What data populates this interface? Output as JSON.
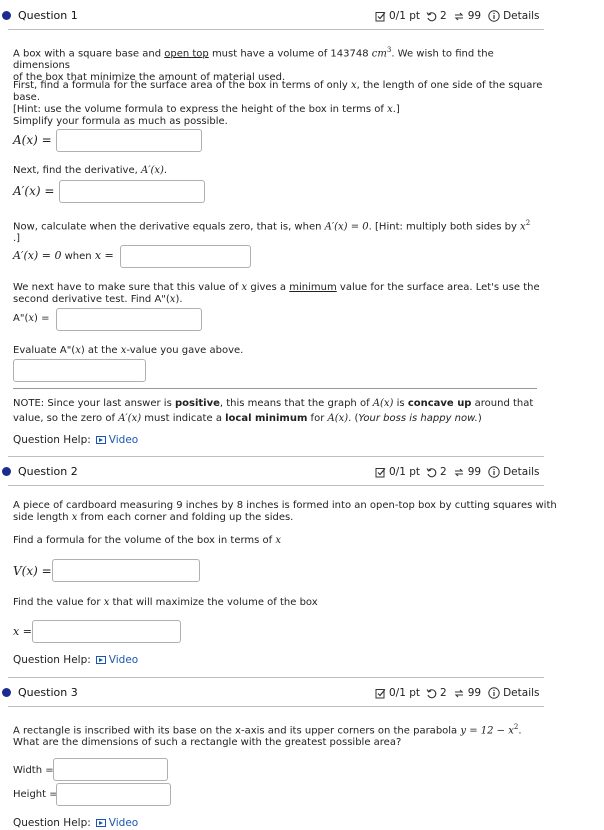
{
  "q1": {
    "title": "Question 1",
    "points": "0/1 pt",
    "retries": "2",
    "attempts": "99",
    "details": "Details",
    "intro_pre": "A box with a square base and ",
    "intro_link": "open top",
    "intro_post": " must have a volume of 143748 ",
    "intro_unit": "cm",
    "intro_unit_sup": "3",
    "intro_tail": ". We wish to find the dimensions",
    "intro_line2": "of the box that minimize the amount of material used.",
    "first_pre": "First, find a formula for the surface area of the box in terms of only ",
    "first_var": "x",
    "first_post": ", the length of one side of the square",
    "first_line2": "base.",
    "hint1_pre": "[Hint: use the volume formula to express the height of the box in terms of ",
    "hint1_var": "x",
    "hint1_post": ".]",
    "simplify": "Simplify your formula as much as possible.",
    "ax_label": "A(x) =",
    "next_pre": "Next, find the derivative, ",
    "next_math": "A′(x)",
    "next_post": ".",
    "apx_label": "A′(x) =",
    "now_pre": "Now, calculate when the derivative equals zero, that is, when ",
    "now_math": "A′(x) = 0",
    "now_post": ". [Hint: multiply both sides by ",
    "now_var": "x",
    "now_sup": "2",
    "now_line2": ".]",
    "zero_label_math": "A′(x) = 0",
    "zero_label_when": " when ",
    "zero_label_x": "x =",
    "min_pre": "We next have to make sure that this value of ",
    "min_var": "x",
    "min_mid": " gives a ",
    "min_link": "minimum",
    "min_post": " value for the surface area. Let's use the",
    "min_line2_pre": "second derivative test. Find A\"(",
    "min_line2_var": "x",
    "min_line2_post": ").",
    "a2x_label_pre": "A\"(",
    "a2x_label_var": "x",
    "a2x_label_post": ") =",
    "eval_pre": "Evaluate A\"(",
    "eval_var": "x",
    "eval_post": ") at the ",
    "eval_var2": "x",
    "eval_tail": "-value you gave above.",
    "note_pre": "NOTE: Since your last answer is ",
    "note_bold1": "positive",
    "note_mid1": ", this means that the graph of ",
    "note_math1": "A(x)",
    "note_mid2": " is ",
    "note_bold2": "concave up",
    "note_post": " around that",
    "note_line2_pre": "value, so the zero of ",
    "note_math2": "A′(x)",
    "note_line2_mid": " must indicate a ",
    "note_bold3": "local minimum",
    "note_line2_mid2": " for ",
    "note_math3": "A(x)",
    "note_line2_mid3": ". (",
    "note_italic": "Your boss is happy now.",
    "note_line2_end": ")",
    "help_label": "Question Help:",
    "help_video": "Video"
  },
  "q2": {
    "title": "Question 2",
    "points": "0/1 pt",
    "retries": "2",
    "attempts": "99",
    "details": "Details",
    "intro": "A piece of cardboard measuring 9 inches by 8 inches is formed into an open-top box by cutting squares with",
    "intro2_pre": "side length ",
    "intro2_var": "x",
    "intro2_post": " from each corner and folding up the sides.",
    "find_pre": "Find a formula for the volume of the box in terms of ",
    "find_var": "x",
    "vx_label": "V(x) =",
    "max_pre": "Find the value for ",
    "max_var": "x",
    "max_post": " that will maximize the volume of the box",
    "x_label": "x =",
    "help_label": "Question Help:",
    "help_video": "Video"
  },
  "q3": {
    "title": "Question 3",
    "points": "0/1 pt",
    "retries": "2",
    "attempts": "99",
    "details": "Details",
    "intro_pre": "A rectangle is inscribed with its base on the x-axis and its upper corners on the parabola ",
    "intro_math": "y = 12 − x",
    "intro_sup": "2",
    "intro_post": ".",
    "intro2": "What are the dimensions of such a rectangle with the greatest possible area?",
    "width_label": "Width =",
    "height_label": "Height =",
    "help_label": "Question Help:",
    "help_video": "Video"
  }
}
